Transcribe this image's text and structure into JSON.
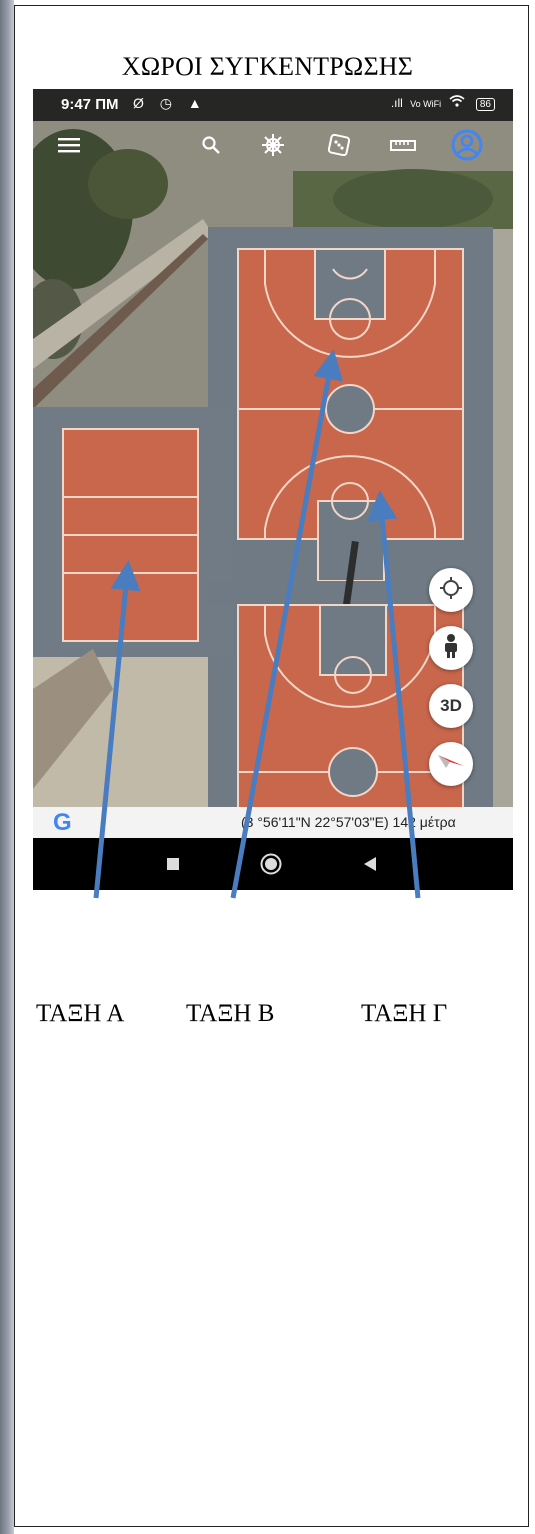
{
  "title": "ΧΩΡΟΙ ΣΥΓΚΕΝΤΡΩΣΗΣ",
  "phone": {
    "status_time": "9:47 ΠΜ",
    "status_left_icons": "Ø ◷ ▲",
    "status_signal": ".ıll",
    "status_wifi_label": "Vo WiFi",
    "battery": "86",
    "fab_3d": "3D",
    "attribution_logo": "G",
    "coords": "(3 °56'11\"N 22°57'03\"E) 142 μέτρα"
  },
  "labels": {
    "a": "ΤΑΞΗ Α",
    "b": "ΤΑΞΗ Β",
    "g": "ΤΑΞΗ Γ"
  },
  "colors": {
    "court": "#c9674c",
    "court_gray": "#707b86",
    "arrow": "#4a7cc0",
    "accent": "#4285f4"
  },
  "icons": [
    "menu-icon",
    "search-icon",
    "ship-wheel-icon",
    "dice-icon",
    "ruler-icon",
    "account-icon",
    "locate-icon",
    "pegman-icon",
    "compass-icon"
  ]
}
